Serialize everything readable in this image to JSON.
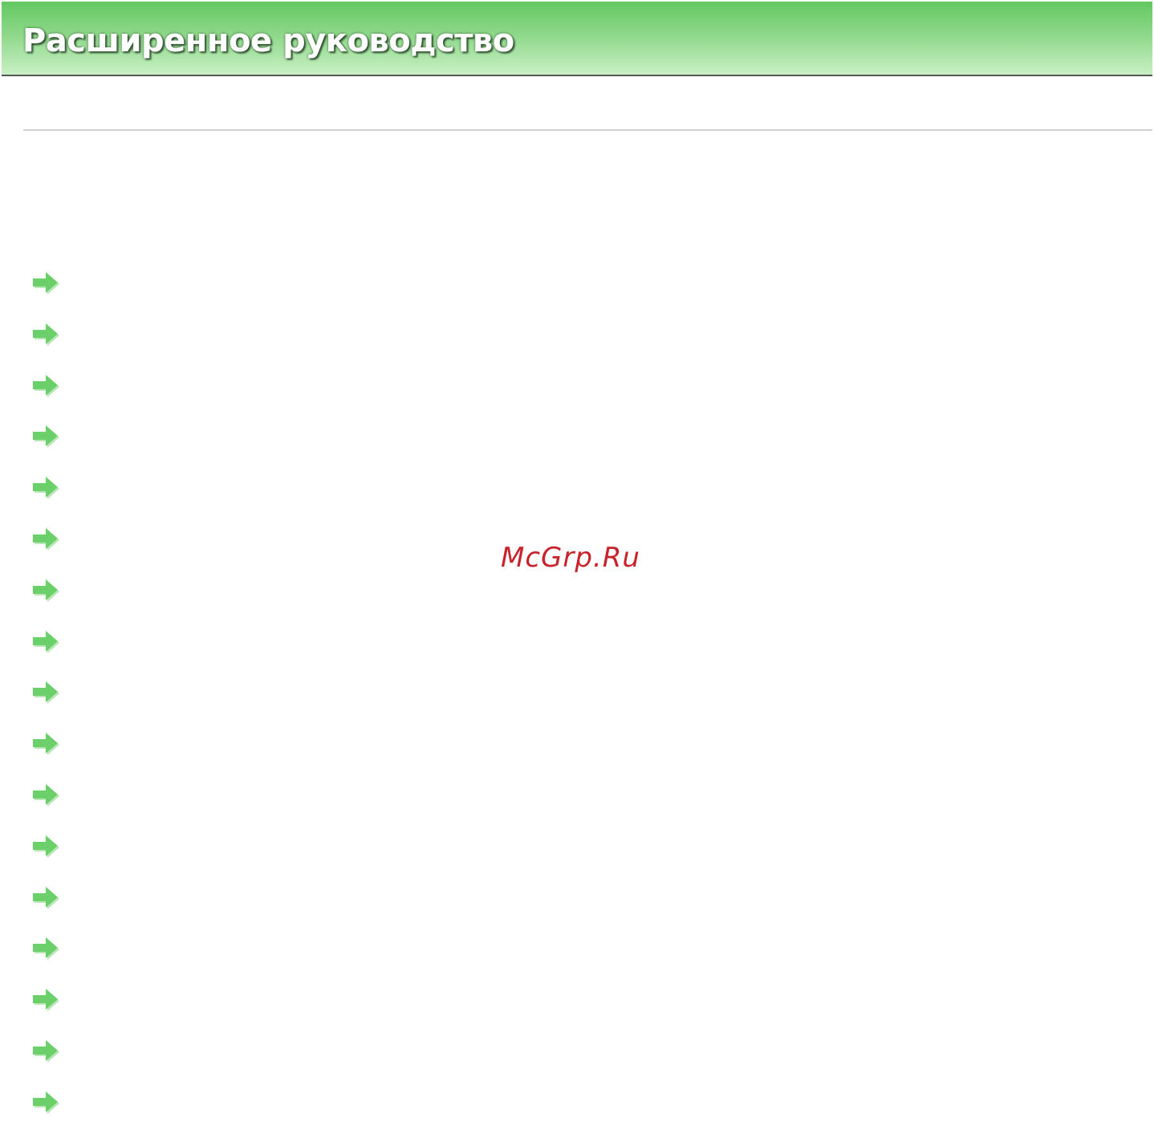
{
  "header": {
    "title": "Расширенное руководство"
  },
  "watermark": {
    "text": "McGrp.Ru"
  },
  "link_list": {
    "icon": "arrow-right-icon",
    "count": 17
  },
  "colors": {
    "header_green_top": "#62c860",
    "header_green_bottom": "#c8f0c4",
    "arrow_green": "#6cd06a",
    "watermark_red": "#c8232a",
    "divider_gray": "#d0d0d0"
  }
}
